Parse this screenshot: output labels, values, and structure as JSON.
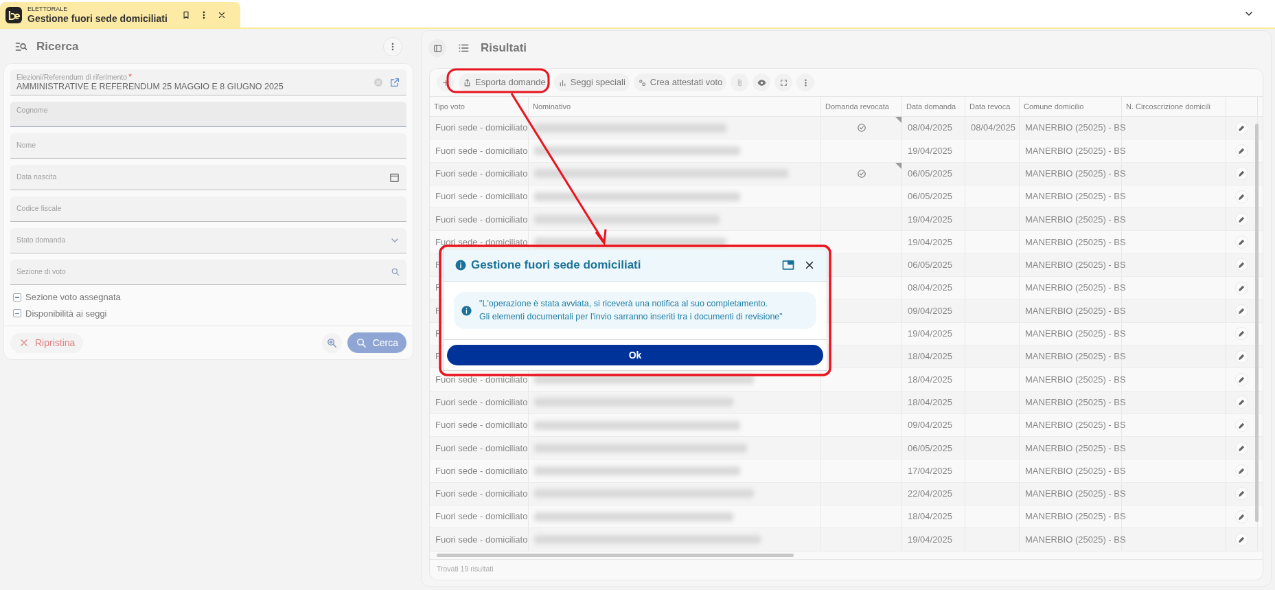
{
  "tab": {
    "app": "ELETTORALE",
    "title": "Gestione fuori sede domiciliati"
  },
  "search_panel": {
    "title": "Ricerca",
    "fields": [
      {
        "kind": "lookup-clear",
        "label": "Elezioni/Referendum di riferimento",
        "required_mark": "*",
        "value": "AMMINISTRATIVE E REFERENDUM 25 MAGGIO E 8 GIUGNO 2025",
        "focused": false
      },
      {
        "kind": "text",
        "label": "Cognome",
        "focused": true
      },
      {
        "kind": "text",
        "label": "Nome",
        "focused": false
      },
      {
        "kind": "date",
        "label": "Data nascita",
        "focused": false
      },
      {
        "kind": "text",
        "label": "Codice fiscale",
        "focused": false
      },
      {
        "kind": "select",
        "label": "Stato domanda",
        "focused": false
      },
      {
        "kind": "search",
        "label": "Sezione di voto",
        "focused": false
      }
    ],
    "checkboxes": [
      {
        "label": "Sezione voto assegnata",
        "indeterminate": true
      },
      {
        "label": "Disponibilità ai seggi",
        "indeterminate": true
      }
    ],
    "reset_button": "Ripristina",
    "search_button": "Cerca"
  },
  "results_panel": {
    "title": "Risultati",
    "toolbar": [
      {
        "kind": "add",
        "disabled": false
      },
      {
        "kind": "export",
        "label": "Esporta domande",
        "disabled": false
      },
      {
        "kind": "chart",
        "label": "Seggi speciali",
        "disabled": false
      },
      {
        "kind": "settings",
        "label": "Crea attestati voto",
        "disabled": false
      },
      {
        "kind": "attach",
        "disabled": true
      },
      {
        "kind": "view",
        "disabled": false
      },
      {
        "kind": "expand",
        "disabled": false
      },
      {
        "kind": "more",
        "disabled": false
      }
    ],
    "columns": [
      "Tipo voto",
      "Nominativo",
      "Domanda revocata",
      "Data domanda",
      "Data revoca",
      "Comune domicilio",
      "N. Circoscrizione domicili"
    ],
    "rows": [
      {
        "tipo_voto": "Fuori sede - domiciliato",
        "revocata": true,
        "data_domanda": "08/04/2025",
        "data_revoca": "08/04/2025",
        "comune": "MANERBIO (25025) - BS"
      },
      {
        "tipo_voto": "Fuori sede - domiciliato",
        "revocata": false,
        "data_domanda": "19/04/2025",
        "comune": "MANERBIO (25025) - BS"
      },
      {
        "tipo_voto": "Fuori sede - domiciliato",
        "revocata": true,
        "data_domanda": "06/05/2025",
        "comune": "MANERBIO (25025) - BS"
      },
      {
        "tipo_voto": "Fuori sede - domiciliato",
        "revocata": false,
        "data_domanda": "06/05/2025",
        "comune": "MANERBIO (25025) - BS"
      },
      {
        "tipo_voto": "Fuori sede - domiciliato",
        "revocata": false,
        "data_domanda": "19/04/2025",
        "comune": "MANERBIO (25025) - BS"
      },
      {
        "tipo_voto": "Fuori sede - domiciliato",
        "revocata": false,
        "data_domanda": "19/04/2025",
        "comune": "MANERBIO (25025) - BS"
      },
      {
        "tipo_voto": "F",
        "revocata": false,
        "data_domanda": "06/05/2025",
        "comune": "MANERBIO (25025) - BS"
      },
      {
        "tipo_voto": "F",
        "revocata": false,
        "data_domanda": "08/04/2025",
        "comune": "MANERBIO (25025) - BS"
      },
      {
        "tipo_voto": "F",
        "revocata": false,
        "data_domanda": "09/04/2025",
        "comune": "MANERBIO (25025) - BS"
      },
      {
        "tipo_voto": "F",
        "revocata": false,
        "data_domanda": "19/04/2025",
        "comune": "MANERBIO (25025) - BS"
      },
      {
        "tipo_voto": "F",
        "revocata": false,
        "data_domanda": "18/04/2025",
        "comune": "MANERBIO (25025) - BS"
      },
      {
        "tipo_voto": "Fuori sede - domiciliato",
        "revocata": false,
        "data_domanda": "18/04/2025",
        "comune": "MANERBIO (25025) - BS"
      },
      {
        "tipo_voto": "Fuori sede - domiciliato",
        "revocata": false,
        "data_domanda": "18/04/2025",
        "comune": "MANERBIO (25025) - BS"
      },
      {
        "tipo_voto": "Fuori sede - domiciliato",
        "revocata": false,
        "data_domanda": "09/04/2025",
        "comune": "MANERBIO (25025) - BS"
      },
      {
        "tipo_voto": "Fuori sede - domiciliato",
        "revocata": false,
        "data_domanda": "06/05/2025",
        "comune": "MANERBIO (25025) - BS"
      },
      {
        "tipo_voto": "Fuori sede - domiciliato",
        "revocata": false,
        "data_domanda": "17/04/2025",
        "comune": "MANERBIO (25025) - BS"
      },
      {
        "tipo_voto": "Fuori sede - domiciliato",
        "revocata": false,
        "data_domanda": "22/04/2025",
        "comune": "MANERBIO (25025) - BS"
      },
      {
        "tipo_voto": "Fuori sede - domiciliato",
        "revocata": false,
        "data_domanda": "18/04/2025",
        "comune": "MANERBIO (25025) - BS"
      },
      {
        "tipo_voto": "Fuori sede - domiciliato",
        "revocata": false,
        "data_domanda": "19/04/2025",
        "comune": "MANERBIO (25025) - BS"
      }
    ],
    "footer": "Trovati 19 risultati"
  },
  "dialog": {
    "title": "Gestione fuori sede domiciliati",
    "message": "\"L'operazione è stata avviata, si riceverà una notifica al suo completamento.\nGli elementi documentali per l'invio sarranno inseriti tra i documenti di revisione\"",
    "button": "Ok"
  }
}
